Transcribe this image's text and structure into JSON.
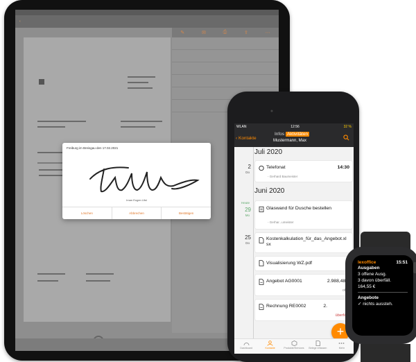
{
  "ipad": {
    "signature_dialog": {
      "title": "Freiburg im Breisgau den 17.02.2021",
      "signer_name": "Iman Eugen Ulst",
      "buttons": [
        "Löschen",
        "Abbrechen",
        "Bestätigen"
      ]
    }
  },
  "iphone": {
    "status": {
      "carrier": "WLAN",
      "time": "12:56",
      "battery": "32 %"
    },
    "nav": {
      "back_label": "Kontakte",
      "segments": [
        "Infos",
        "Aktivitäten"
      ],
      "active_segment": "Aktivitäten",
      "subtitle": "Mustermann, Max"
    },
    "feed": {
      "months": [
        "Juli 2020",
        "Juni 2020"
      ],
      "dates": [
        {
          "day": "2",
          "weekday": "Do"
        },
        {
          "day": "29",
          "weekday": "Mo",
          "prefix": "Heute"
        },
        {
          "day": "25",
          "weekday": "Do"
        }
      ],
      "items": [
        {
          "title": "Telefonat",
          "time": "14:30",
          "meta": "- Gerhard Baumeister"
        },
        {
          "title": "Glaswand für Dusche bestellen",
          "meta": "- Gerhar...umeister"
        },
        {
          "title": "Kostenkalkulation_für_das_Angebot.xlsx"
        },
        {
          "title": "Visualisierung WZ.pdf"
        },
        {
          "title": "Angebot AG0001",
          "amount": "2.988,48 €",
          "status": "offen"
        },
        {
          "title": "Rechnung RE0002",
          "amount": "2.",
          "status": "überfällig"
        }
      ]
    },
    "tabbar": [
      {
        "label": "Dashboard",
        "icon": "gauge-icon"
      },
      {
        "label": "Kontakte",
        "icon": "person-icon",
        "active": true
      },
      {
        "label": "Produkte/Services",
        "icon": "box-icon"
      },
      {
        "label": "Belege erfassen",
        "icon": "document-add-icon"
      },
      {
        "label": "Mehr",
        "icon": "more-icon"
      }
    ],
    "accent_color": "#ff8a00"
  },
  "watch": {
    "brand": "lexoffice",
    "time": "15:51",
    "section1_title": "Ausgaben",
    "section1_lines": [
      "3 offene Ausg.",
      "3 davon überfäll.",
      "164,55 €"
    ],
    "section2_title": "Angebote",
    "section2_line": "✓ nichts aussteh."
  }
}
